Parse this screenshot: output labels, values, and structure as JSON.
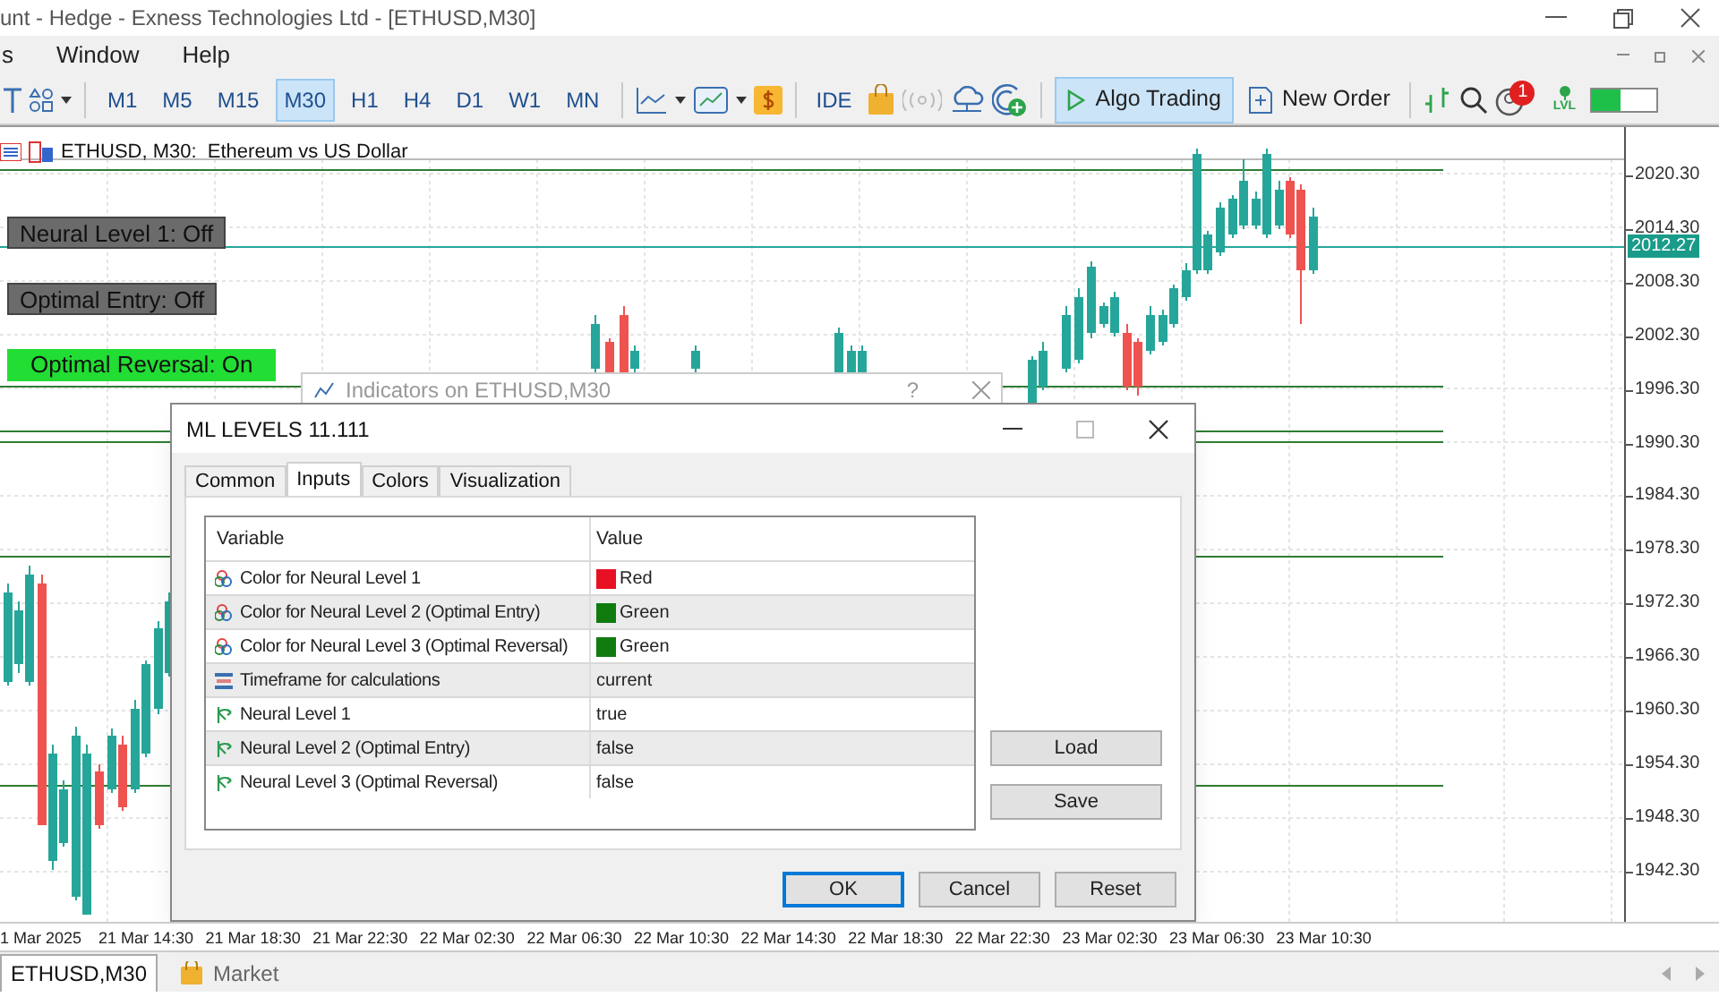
{
  "window": {
    "title": "unt - Hedge - Exness Technologies Ltd - [ETHUSD,M30]"
  },
  "menu": [
    "s",
    "Window",
    "Help"
  ],
  "toolbar": {
    "timeframes": [
      {
        "label": "M1",
        "selected": false
      },
      {
        "label": "M5",
        "selected": false
      },
      {
        "label": "M15",
        "selected": false
      },
      {
        "label": "M30",
        "selected": true
      },
      {
        "label": "H1",
        "selected": false
      },
      {
        "label": "H4",
        "selected": false
      },
      {
        "label": "D1",
        "selected": false
      },
      {
        "label": "W1",
        "selected": false
      },
      {
        "label": "MN",
        "selected": false
      }
    ],
    "ide": "IDE",
    "algo_trading": {
      "label": "Algo Trading",
      "on": true
    },
    "new_order": "New Order",
    "notification_count": "1",
    "lvl": "LVL",
    "meter": {
      "level": 0.43
    }
  },
  "chart": {
    "header": "ETHUSD, M30:  Ethereum vs US Dollar",
    "labels": [
      {
        "text": "Neural Level 1: Off",
        "on": false
      },
      {
        "text": "Optimal Entry: Off",
        "on": false
      },
      {
        "text": "Optimal Reversal: On",
        "on": true
      }
    ],
    "price_labels": [
      "2020.30",
      "2014.30",
      "2008.30",
      "2002.30",
      "1996.30",
      "1990.30",
      "1984.30",
      "1978.30",
      "1972.30",
      "1966.30",
      "1960.30",
      "1954.30",
      "1948.30",
      "1942.30"
    ],
    "current_price": "2012.27",
    "time_labels": [
      "1 Mar 2025",
      "21 Mar 14:30",
      "21 Mar 18:30",
      "21 Mar 22:30",
      "22 Mar 02:30",
      "22 Mar 06:30",
      "22 Mar 10:30",
      "22 Mar 14:30",
      "22 Mar 18:30",
      "22 Mar 22:30",
      "23 Mar 02:30",
      "23 Mar 06:30",
      "23 Mar 10:30"
    ]
  },
  "back_dialog": {
    "title": "Indicators on ETHUSD,M30",
    "help": "?"
  },
  "dialog": {
    "title": "ML LEVELS 11.111",
    "tabs": [
      {
        "label": "Common",
        "selected": false
      },
      {
        "label": "Inputs",
        "selected": true
      },
      {
        "label": "Colors",
        "selected": false
      },
      {
        "label": "Visualization",
        "selected": false
      }
    ],
    "columns": [
      "Variable",
      "Value"
    ],
    "rows": [
      {
        "kind": "color",
        "variable": "Color for Neural Level 1",
        "value": "Red",
        "color": "#e81123"
      },
      {
        "kind": "color",
        "variable": "Color for Neural Level 2 (Optimal Entry)",
        "value": "Green",
        "color": "#107c10"
      },
      {
        "kind": "color",
        "variable": "Color for Neural Level 3 (Optimal Reversal)",
        "value": "Green",
        "color": "#107c10"
      },
      {
        "kind": "enum",
        "variable": "Timeframe for calculations",
        "value": "current"
      },
      {
        "kind": "bool",
        "variable": "Neural Level 1",
        "value": "true"
      },
      {
        "kind": "bool",
        "variable": "Neural Level 2 (Optimal Entry)",
        "value": "false"
      },
      {
        "kind": "bool",
        "variable": "Neural Level 3 (Optimal Reversal)",
        "value": "false"
      }
    ],
    "side_buttons": [
      "Load",
      "Save"
    ],
    "buttons": [
      {
        "label": "OK",
        "selected": true
      },
      {
        "label": "Cancel",
        "selected": false
      },
      {
        "label": "Reset",
        "selected": false
      }
    ]
  },
  "bottom_tabs": [
    {
      "label": "ETHUSD,M30",
      "selected": true,
      "kind": "chart"
    },
    {
      "label": "Market",
      "selected": false,
      "kind": "market"
    }
  ]
}
